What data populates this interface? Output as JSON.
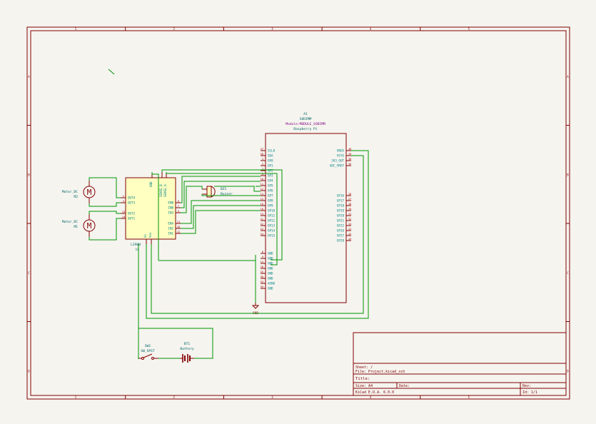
{
  "frame": {
    "columns": [
      "1",
      "2",
      "3",
      "4",
      "5"
    ],
    "rows": [
      "A",
      "B",
      "C",
      "D"
    ]
  },
  "title_block": {
    "sheet": "Sheet: /",
    "file": "File: Project.kicad_sch",
    "title": "Title:",
    "size": "Size: A4",
    "date": "Date:",
    "rev": "Rev:",
    "tool": "KiCad E.D.A. 6.0.0",
    "id": "Id: 1/1"
  },
  "components": {
    "a1": {
      "ref": "A1",
      "value": "SODIMM",
      "footprint": "Module:MODULE_SODIMM",
      "name": "Raspberry Pi",
      "left_pins": [
        {
          "num": "37",
          "name": "SCL0"
        },
        {
          "num": "38",
          "name": "SDA"
        },
        {
          "num": "3",
          "name": "GP0"
        },
        {
          "num": "5",
          "name": "GP1"
        },
        {
          "num": "7",
          "name": "GP2"
        },
        {
          "num": "8",
          "name": "GP3"
        },
        {
          "num": "10",
          "name": "GP4"
        },
        {
          "num": "11",
          "name": "GP5"
        },
        {
          "num": "12",
          "name": "GP6"
        },
        {
          "num": "13",
          "name": "GP7"
        },
        {
          "num": "15",
          "name": "GP8"
        },
        {
          "num": "16",
          "name": "GP9"
        },
        {
          "num": "18",
          "name": "GP10"
        },
        {
          "num": "19",
          "name": "GP11"
        },
        {
          "num": "21",
          "name": "GP12"
        },
        {
          "num": "22",
          "name": "GP13"
        },
        {
          "num": "23",
          "name": "GP14"
        },
        {
          "num": "24",
          "name": "GP15"
        },
        {
          "num": "6",
          "name": "GND"
        },
        {
          "num": "9",
          "name": "GND"
        },
        {
          "num": "14",
          "name": "GND"
        },
        {
          "num": "20",
          "name": "GND"
        },
        {
          "num": "25",
          "name": "GND"
        },
        {
          "num": "30",
          "name": "GND"
        },
        {
          "num": "33",
          "name": "AGND"
        },
        {
          "num": "39",
          "name": "GND"
        }
      ],
      "right_pins": [
        {
          "num": "40",
          "name": "VBUS"
        },
        {
          "num": "39",
          "name": "VSYS"
        },
        {
          "num": "36",
          "name": "3V3_OUT"
        },
        {
          "num": "35",
          "name": "ADC_VREF"
        },
        {
          "num": "26",
          "name": "GP16"
        },
        {
          "num": "27",
          "name": "GP17"
        },
        {
          "num": "28",
          "name": "GP18"
        },
        {
          "num": "29",
          "name": "GP19"
        },
        {
          "num": "31",
          "name": "GP20"
        },
        {
          "num": "32",
          "name": "GP21"
        },
        {
          "num": "34",
          "name": "GP22"
        },
        {
          "num": "41",
          "name": "GP26"
        },
        {
          "num": "42",
          "name": "GP27"
        },
        {
          "num": "43",
          "name": "GP28"
        }
      ]
    },
    "u1": {
      "ref": "U1",
      "value": "L298N",
      "left_pins": [
        {
          "num": "2",
          "name": "OUT4"
        },
        {
          "num": "3",
          "name": "OUT3"
        },
        {
          "num": "13",
          "name": "OUT2"
        },
        {
          "num": "14",
          "name": "OUT1"
        }
      ],
      "right_pins": [
        {
          "num": "6",
          "name": "ENB"
        },
        {
          "num": "7",
          "name": "INB"
        },
        {
          "num": "5",
          "name": "IN3"
        },
        {
          "num": "11",
          "name": "ENA"
        },
        {
          "num": "10",
          "name": "IN2"
        },
        {
          "num": "12",
          "name": "IN1"
        }
      ],
      "top_pins": [
        "GND",
        "SENSE_B",
        "SENSE_A"
      ],
      "bottom_pins": [
        "Vs",
        "Vss"
      ]
    },
    "m2": {
      "ref": "M2",
      "value": "Motor_DC"
    },
    "m1": {
      "ref": "M1",
      "value": "Motor_DC"
    },
    "bz1": {
      "ref": "BZ1",
      "value": "Buzzer"
    },
    "sw1": {
      "ref": "SW1",
      "value": "SW_SPST"
    },
    "bt1": {
      "ref": "BT1",
      "value": "Battery"
    },
    "gnd": {
      "value": "GND"
    }
  }
}
